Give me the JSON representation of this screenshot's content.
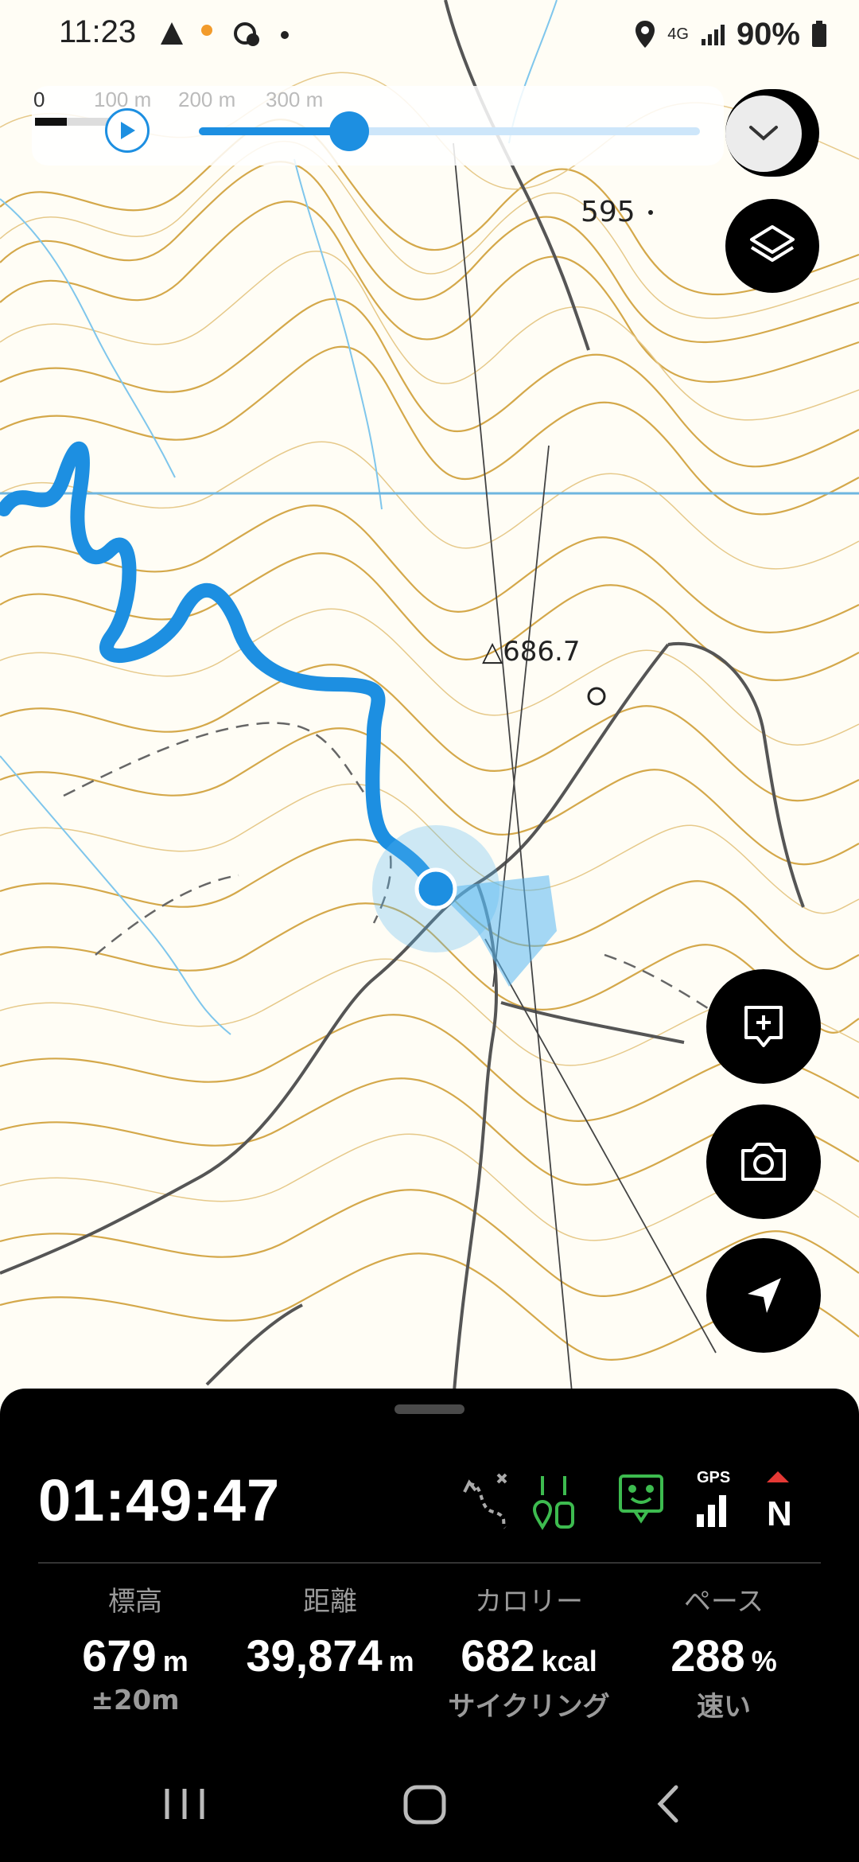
{
  "status_bar": {
    "time": "11:23",
    "battery": "90%",
    "network": "4G"
  },
  "map": {
    "spot_elevation": "595",
    "triangulation_point": "686.7",
    "scale_labels": [
      "0",
      "100 m",
      "200 m",
      "300 m"
    ],
    "playback_progress": 0.3,
    "route_color": "#1d8fe1"
  },
  "panel": {
    "elapsed_time": "01:49:47",
    "status_icons": [
      "route-icon",
      "waypoint-pair-icon",
      "message-face-icon",
      "gps-signal-icon",
      "compass-north-icon"
    ],
    "gps_label": "GPS",
    "north_label": "N",
    "stats": [
      {
        "label": "標高",
        "value": "679",
        "unit": "m",
        "sub": "±20m"
      },
      {
        "label": "距離",
        "value": "39,874",
        "unit": "m",
        "sub": ""
      },
      {
        "label": "カロリー",
        "value": "682",
        "unit": "kcal",
        "sub": "サイクリング"
      },
      {
        "label": "ペース",
        "value": "288",
        "unit": "%",
        "sub": "速い"
      }
    ]
  },
  "buttons": [
    "layers-icon",
    "add-comment-icon",
    "camera-icon",
    "location-arrow-icon"
  ]
}
